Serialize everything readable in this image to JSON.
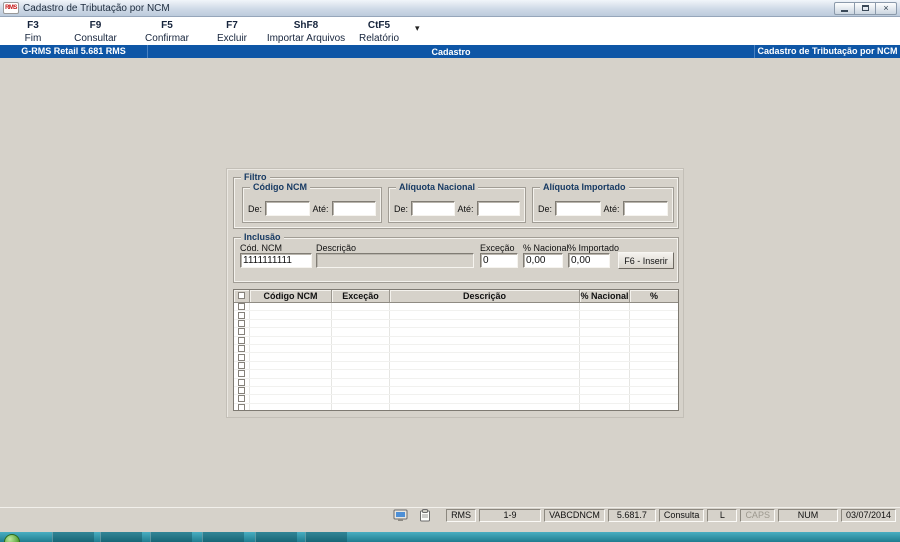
{
  "window": {
    "title": "Cadastro de Tributação por NCM",
    "icon_text": "RMS"
  },
  "toolbar": {
    "buttons": [
      {
        "key": "F3",
        "label": "Fim"
      },
      {
        "key": "F9",
        "label": "Consultar"
      },
      {
        "key": "F5",
        "label": "Confirmar"
      },
      {
        "key": "F7",
        "label": "Excluir"
      },
      {
        "key": "ShF8",
        "label": "Importar Arquivos"
      },
      {
        "key": "CtF5",
        "label": "Relatório"
      }
    ],
    "dropdown_glyph": "▾"
  },
  "header_bar": {
    "left": "G-RMS Retail 5.681 RMS",
    "center": "Cadastro",
    "right": "Cadastro de Tributação por NCM",
    "background": "#0e56a6"
  },
  "filtro": {
    "title": "Filtro",
    "groups": [
      {
        "title": "Código NCM",
        "de": "De:",
        "ate": "Até:",
        "de_value": "",
        "ate_value": ""
      },
      {
        "title": "Alíquota Nacional",
        "de": "De:",
        "ate": "Até:",
        "de_value": "",
        "ate_value": ""
      },
      {
        "title": "Alíquota Importado",
        "de": "De:",
        "ate": "Até:",
        "de_value": "",
        "ate_value": ""
      }
    ]
  },
  "inclusao": {
    "title": "Inclusão",
    "cod_ncm_label": "Cód. NCM",
    "cod_ncm_value": "1111111111",
    "descricao_label": "Descrição",
    "descricao_value": "",
    "excecao_label": "Exceção",
    "excecao_value": "0",
    "nacional_label": "% Nacional",
    "nacional_value": "0,00",
    "importado_label": "% Importado",
    "importado_value": "0,00",
    "insert_button": "F6 - Inserir"
  },
  "table": {
    "headers": [
      "Código NCM",
      "Exceção",
      "Descrição",
      "% Nacional",
      "% Importado"
    ],
    "row_count": 13
  },
  "statusbar": {
    "icons": [
      "computer-icon",
      "notepad-icon"
    ],
    "cells": [
      {
        "text": "RMS",
        "disabled": false
      },
      {
        "text": "1-9",
        "disabled": false
      },
      {
        "text": "VABCDNCM",
        "disabled": false
      },
      {
        "text": "5.681.7",
        "disabled": false
      },
      {
        "text": "Consulta",
        "disabled": false
      },
      {
        "text": "L",
        "disabled": false
      },
      {
        "text": "CAPS",
        "disabled": true
      },
      {
        "text": "NUM",
        "disabled": false
      },
      {
        "text": "03/07/2014",
        "disabled": false
      }
    ]
  }
}
